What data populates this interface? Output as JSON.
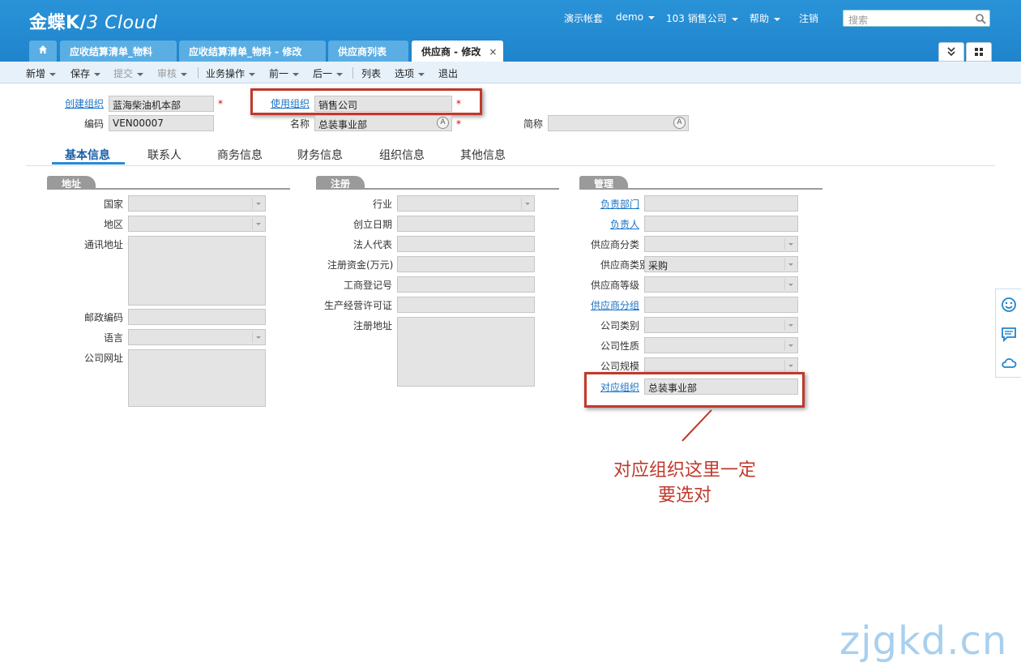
{
  "app": {
    "logo_main": "金蝶K/",
    "logo_sub": "3 Cloud",
    "watermark": "zjgkd.cn"
  },
  "topnav": {
    "demo_account": "演示帐套",
    "user": "demo",
    "org": "103 销售公司",
    "help": "帮助",
    "logout": "注销",
    "search_placeholder": "搜索"
  },
  "tabs": [
    {
      "label": "应收结算清单_物料"
    },
    {
      "label": "应收结算清单_物料 - 修改"
    },
    {
      "label": "供应商列表"
    },
    {
      "label": "供应商 - 修改",
      "close": "×"
    }
  ],
  "toolbar": {
    "new": "新增",
    "save": "保存",
    "submit": "提交",
    "audit": "审核",
    "business_ops": "业务操作",
    "prev": "前一",
    "next": "后一",
    "list": "列表",
    "options": "选项",
    "exit": "退出"
  },
  "header": {
    "create_org_label": "创建组织",
    "create_org_value": "蓝海柴油机本部",
    "use_org_label": "使用组织",
    "use_org_value": "销售公司",
    "code_label": "编码",
    "code_value": "VEN00007",
    "name_label": "名称",
    "name_value": "总装事业部",
    "short_label": "简称",
    "short_value": "",
    "required_mark": "*",
    "multilang_glyph": "A"
  },
  "subtabs": [
    "基本信息",
    "联系人",
    "商务信息",
    "财务信息",
    "组织信息",
    "其他信息"
  ],
  "address": {
    "title": "地址",
    "country": "国家",
    "region": "地区",
    "mail_address": "通讯地址",
    "postcode": "邮政编码",
    "language": "语言",
    "website": "公司网址"
  },
  "register": {
    "title": "注册",
    "industry": "行业",
    "founded": "创立日期",
    "legal_rep": "法人代表",
    "capital": "注册资金(万元)",
    "biz_reg_no": "工商登记号",
    "license": "生产经营许可证",
    "reg_address": "注册地址"
  },
  "manage": {
    "title": "管理",
    "dept": "负责部门",
    "owner": "负责人",
    "supplier_class": "供应商分类",
    "supplier_type": "供应商类别",
    "supplier_type_value": "采购",
    "supplier_grade": "供应商等级",
    "supplier_group": "供应商分组",
    "company_type": "公司类别",
    "company_nature": "公司性质",
    "company_scale": "公司规模",
    "corr_org": "对应组织",
    "corr_org_value": "总装事业部"
  },
  "annotation": {
    "line1": "对应组织这里一定",
    "line2": "要选对"
  },
  "colors": {
    "header_blue": "#2a93d8",
    "annotation_red": "#c0392b",
    "link_blue": "#1a73c5"
  }
}
